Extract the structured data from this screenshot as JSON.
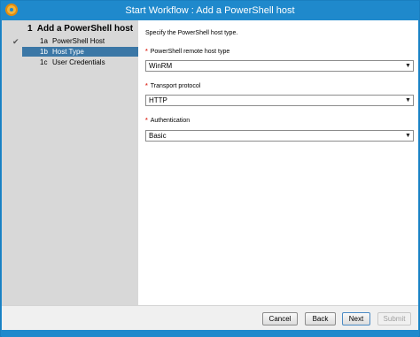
{
  "window": {
    "title": "Start Workflow : Add a PowerShell host"
  },
  "sidebar": {
    "heading_number": "1",
    "heading_label": "Add a PowerShell host",
    "items": [
      {
        "number": "1a",
        "label": "PowerShell Host",
        "completed": true
      },
      {
        "number": "1b",
        "label": "Host Type",
        "active": true
      },
      {
        "number": "1c",
        "label": "User Credentials"
      }
    ]
  },
  "main": {
    "instructions": "Specify the PowerShell host type.",
    "required_marker": "*",
    "fields": [
      {
        "label": "PowerShell remote host type",
        "value": "WinRM"
      },
      {
        "label": "Transport protocol",
        "value": "HTTP"
      },
      {
        "label": "Authentication",
        "value": "Basic"
      }
    ]
  },
  "footer": {
    "cancel": "Cancel",
    "back": "Back",
    "next": "Next",
    "submit": "Submit"
  },
  "colors": {
    "titlebar": "#1f89cc",
    "active_step": "#3b77a6",
    "required": "#e03a2f"
  }
}
